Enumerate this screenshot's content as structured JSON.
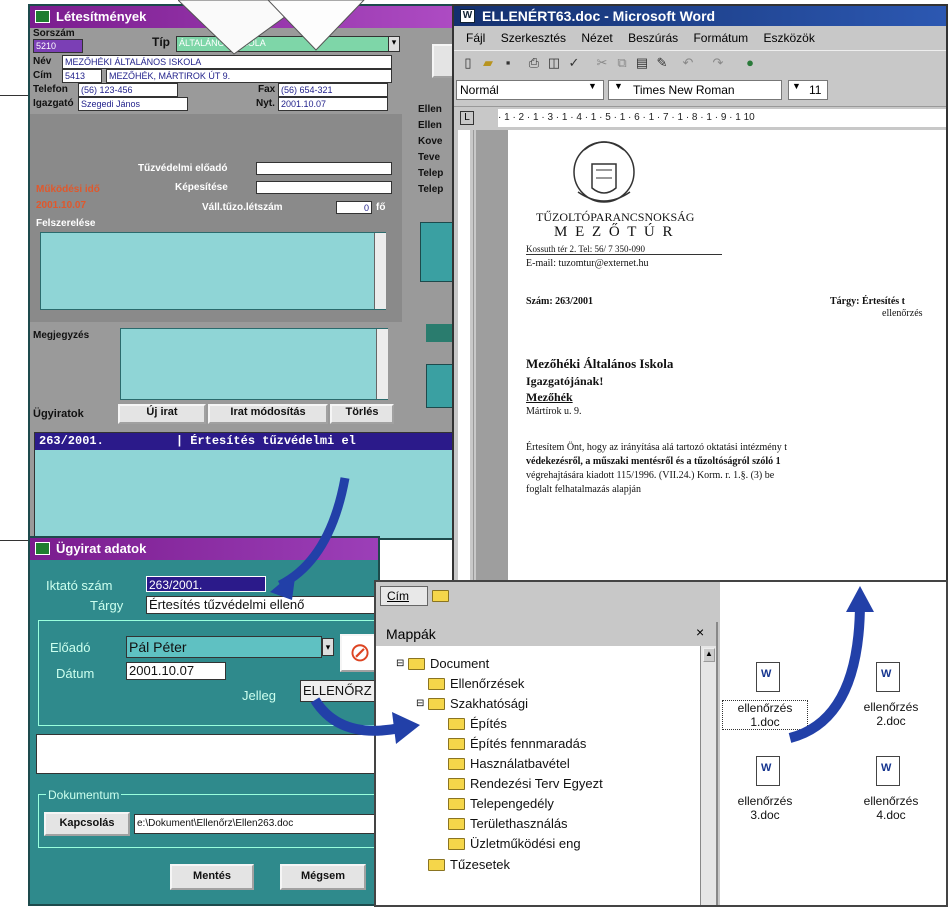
{
  "win1": {
    "title": "Létesítmények",
    "sorszam_label": "Sorszám",
    "sorszam_value": "5210",
    "tip_label": "Típ",
    "tip_value": "ÁLTALÁNOS ISKOLA",
    "nev_label": "Név",
    "nev_value": "MEZŐHÉKI ÁLTALÁNOS ISKOLA",
    "cim_label": "Cím",
    "cim_zip": "5413",
    "cim_value": "MEZŐHÉK, MÁRTIROK ÚT 9.",
    "telefon_label": "Telefon",
    "telefon_value": "(56) 123-456",
    "fax_label": "Fax",
    "fax_value": "(56) 654-321",
    "igazgato_label": "Igazgató",
    "igazgato_value": "Szegedi János",
    "nyt_label": "Nyt.",
    "nyt_value": "2001.10.07",
    "tuzvedelmi_label": "Tűzvédelmi előadó",
    "kepesites_label": "Képesítése",
    "vall_label": "Váll.tűzo.létszám",
    "vall_value": "0",
    "vall_unit": "fő",
    "side_red1": "Működési idő",
    "side_red2": "2001.10.07",
    "felszereles_label": "Felszerelése",
    "megjegyzes_label": "Megjegyzés",
    "ugyiratok_label": "Ügyiratok",
    "btn_uj": "Új irat",
    "btn_mod": "Irat módosítás",
    "btn_torles": "Törlés",
    "right_labels": [
      "Ellen",
      "Ellen",
      "Kove",
      "Teve",
      "Telep",
      "Telep"
    ],
    "list_row": "263/2001.          | Értesítés tűzvédelmi el"
  },
  "win2": {
    "title": "Ügyirat adatok",
    "iktato_label": "Iktató szám",
    "iktato_value": "263/2001.",
    "targy_label": "Tárgy",
    "targy_value": "Értesítés tűzvédelmi ellenő",
    "eloado_label": "Előadó",
    "eloado_value": "Pál Péter",
    "datum_label": "Dátum",
    "datum_value": "2001.10.07",
    "jelleg_label": "Jelleg",
    "jelleg_value": "ELLENŐRZ",
    "dok_label": "Dokumentum",
    "btn_kapcsolas": "Kapcsolás",
    "path_value": "e:\\Dokument\\Ellenőrz\\Ellen263.doc",
    "btn_mentes": "Mentés",
    "btn_megsem": "Mégsem"
  },
  "word": {
    "title": "ELLENÉRT63.doc - Microsoft Word",
    "menu": [
      "Fájl",
      "Szerkesztés",
      "Nézet",
      "Beszúrás",
      "Formátum",
      "Eszközök"
    ],
    "style_value": "Normál",
    "font_value": "Times New Roman",
    "size_value": "11",
    "ruler": "· 1 · 2 · 1 · 3 · 1 · 4 · 1 · 5 · 1 · 6 · 1 · 7 · 1 · 8 · 1 · 9 · 1 10",
    "org1": "TŰZOLTÓPARANCSNOKSÁG",
    "org2": "M E Z Ő T Ú R",
    "addr": "Kossuth tér 2. Tel: 56/ 7   350-090",
    "email": "E-mail: tuzomtur@externet.hu",
    "szam": "Szám: 263/2001",
    "targy": "Tárgy: Értesítés t",
    "targy2": "ellenőrzés",
    "rec1": "Mezőhéki Általános Iskola",
    "rec2": "Igazgatójának!",
    "rec3": "Mezőhék",
    "rec4": "Mártírok u. 9.",
    "body1": "Értesítem Önt, hogy az irányítása alá tartozó oktatási intézmény t",
    "body2": "védekezésről, a műszaki mentésről és a tűzoltóságról szóló  1",
    "body3": "végrehajtására kiadott 115/1996. (VII.24.) Korm. r. 1.§. (3) be",
    "body4": "foglalt felhatalmazás alapján"
  },
  "explorer": {
    "tab_label": "Cím",
    "panel_title": "Mappák",
    "close_glyph": "×",
    "tree": [
      "Document",
      "Ellenőrzések",
      "Szakhatósági",
      "Építés",
      "Építés fennmaradás",
      "Használatbavétel",
      "Rendezési Terv Egyezt",
      "Telepengedély",
      "Területhasználás",
      "Üzletműködési eng",
      "Tűzesetek"
    ],
    "files": [
      {
        "l1": "ellenőrzés",
        "l2": "1.doc"
      },
      {
        "l1": "ellenőrzés",
        "l2": "2.doc"
      },
      {
        "l1": "ellenőrzés",
        "l2": "3.doc"
      },
      {
        "l1": "ellenőrzés",
        "l2": "4.doc"
      }
    ]
  },
  "colors": {
    "teal": "#3aa0a2",
    "purple_title": "#7a1c8e",
    "word_title": "#14306e",
    "arrow": "#2240a8"
  }
}
